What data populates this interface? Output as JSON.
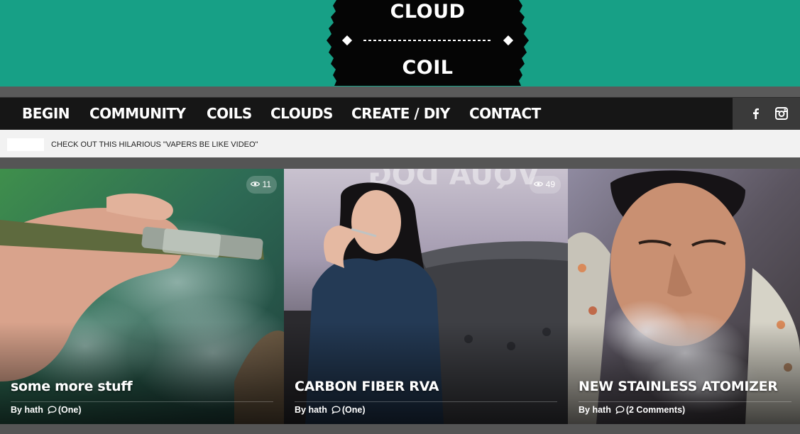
{
  "logo": {
    "top": "CLOUD",
    "bottom": "COIL"
  },
  "nav": {
    "items": [
      {
        "label": "BEGIN"
      },
      {
        "label": "COMMUNITY"
      },
      {
        "label": "COILS"
      },
      {
        "label": "CLOUDS"
      },
      {
        "label": "CREATE / DIY"
      },
      {
        "label": "CONTACT"
      }
    ],
    "social": [
      "facebook-icon",
      "instagram-icon"
    ]
  },
  "ticker": {
    "text": "CHECK OUT THIS HILARIOUS \"VAPERS BE LIKE VIDEO\""
  },
  "cards": [
    {
      "title": "some more stuff",
      "views": "11",
      "author": "By hath",
      "comments": "(One)"
    },
    {
      "title": "CARBON FIBER RVA",
      "views": "49",
      "author": "By hath",
      "comments": "(One)"
    },
    {
      "title": "NEW STAINLESS ATOMIZER",
      "views": "",
      "author": "By hath",
      "comments": "(2 Comments)"
    }
  ],
  "colors": {
    "header": "#17a086",
    "nav": "#161616",
    "ticker_bg": "#f2f2f2"
  }
}
